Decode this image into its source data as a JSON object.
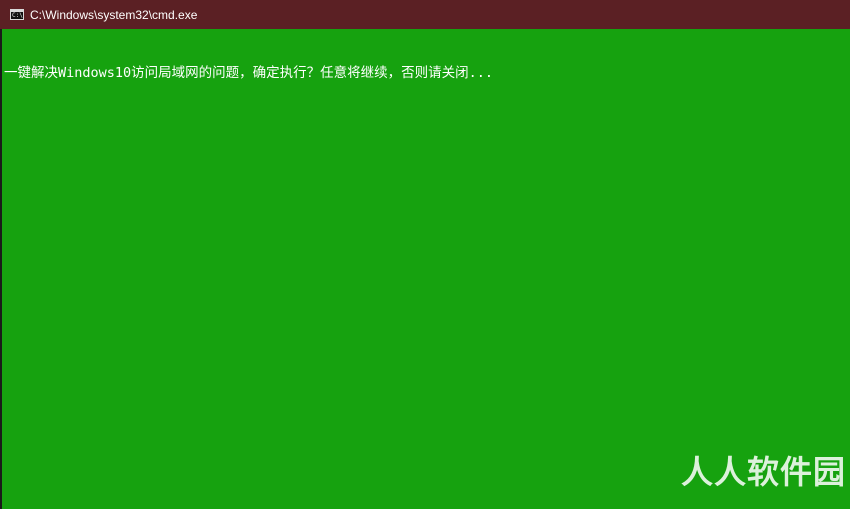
{
  "window": {
    "title": "C:\\Windows\\system32\\cmd.exe",
    "icon": "cmd-console-icon",
    "icon_text": "C:\\"
  },
  "console": {
    "output_line": "一键解决Windows10访问局域网的问题，确定执行？任意将继续，否则请关闭..."
  },
  "watermark": {
    "text": "人人软件园"
  },
  "colors": {
    "background": "#16a20f",
    "titlebar": "#5b2024",
    "text": "#ffffff"
  }
}
